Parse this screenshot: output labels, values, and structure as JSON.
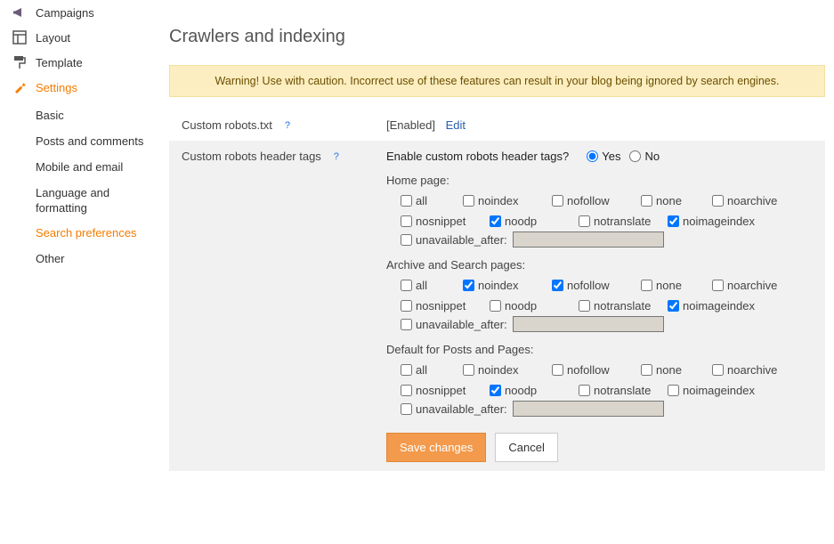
{
  "sidebar": {
    "items": [
      {
        "label": "Campaigns"
      },
      {
        "label": "Layout"
      },
      {
        "label": "Template"
      },
      {
        "label": "Settings"
      }
    ],
    "settings_sub": [
      {
        "label": "Basic"
      },
      {
        "label": "Posts and comments"
      },
      {
        "label": "Mobile and email"
      },
      {
        "label": "Language and formatting"
      },
      {
        "label": "Search preferences"
      },
      {
        "label": "Other"
      }
    ]
  },
  "main": {
    "title": "Crawlers and indexing",
    "warning": "Warning! Use with caution. Incorrect use of these features can result in your blog being ignored by search engines.",
    "robots_txt": {
      "label": "Custom robots.txt",
      "status": "[Enabled]",
      "edit": "Edit"
    },
    "header_tags": {
      "label": "Custom robots header tags",
      "enable_question": "Enable custom robots header tags?",
      "yes": "Yes",
      "no": "No",
      "sections": {
        "home": "Home page:",
        "archive": "Archive and Search pages:",
        "posts": "Default for Posts and Pages:"
      },
      "opts": {
        "all": "all",
        "noindex": "noindex",
        "nofollow": "nofollow",
        "none": "none",
        "noarchive": "noarchive",
        "nosnippet": "nosnippet",
        "noodp": "noodp",
        "notranslate": "notranslate",
        "noimageindex": "noimageindex",
        "unavailable_after": "unavailable_after:"
      },
      "save": "Save changes",
      "cancel": "Cancel"
    }
  },
  "state": {
    "enable": "yes",
    "home": {
      "noodp": true,
      "noimageindex": true
    },
    "archive": {
      "noindex": true,
      "nofollow": true,
      "noimageindex": true
    },
    "posts": {
      "noodp": true
    }
  }
}
